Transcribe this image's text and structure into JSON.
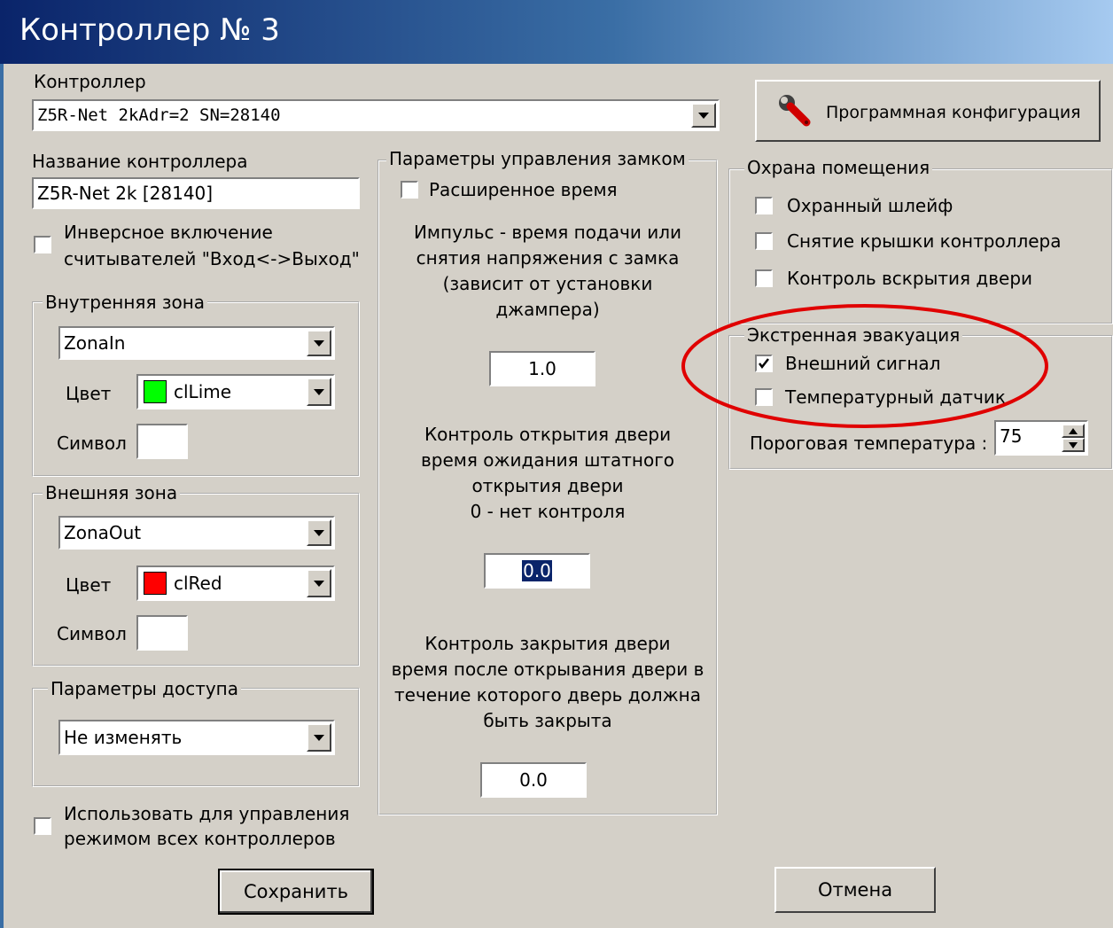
{
  "window": {
    "title": "Контроллер № 3"
  },
  "controller": {
    "label": "Контроллер",
    "value": "Z5R-Net 2kAdr=2 SN=28140"
  },
  "name": {
    "label": "Название контроллера",
    "value": "Z5R-Net 2k [28140]"
  },
  "inverse_readers": {
    "line1": "Инверсное включение",
    "line2": "считывателей \"Вход<->Выход\"",
    "checked": false
  },
  "inner_zone": {
    "title": "Внутренняя зона",
    "zone": "ZonaIn",
    "color_label": "Цвет",
    "color_value": "clLime",
    "color_hex": "#00ff00",
    "symbol_label": "Символ",
    "symbol_value": ""
  },
  "outer_zone": {
    "title": "Внешняя зона",
    "zone": "ZonaOut",
    "color_label": "Цвет",
    "color_value": "clRed",
    "color_hex": "#ff0000",
    "symbol_label": "Символ",
    "symbol_value": ""
  },
  "access": {
    "title": "Параметры доступа",
    "value": "Не изменять"
  },
  "use_for_all": {
    "line1": "Использовать для управления",
    "line2": "режимом всех контроллеров",
    "checked": false
  },
  "lock": {
    "title": "Параметры управления замком",
    "extended_time": {
      "label": "Расширенное время",
      "checked": false
    },
    "pulse": {
      "lines": [
        "Импульс - время подачи или",
        "снятия напряжения с замка",
        "(зависит от установки",
        "джампера)"
      ],
      "value": "1.0"
    },
    "open_control": {
      "lines": [
        "Контроль открытия двери",
        "время ожидания штатного",
        "открытия двери",
        "0 - нет контроля"
      ],
      "value": "0.0"
    },
    "close_control": {
      "lines": [
        "Контроль закрытия двери",
        "время после открывания двери в",
        "течение которого дверь должна",
        "быть закрыта"
      ],
      "value": "0.0"
    }
  },
  "prog_config": {
    "label": "Программная конфигурация",
    "icon": "wrench-icon"
  },
  "security": {
    "title": "Охрана помещения",
    "items": [
      {
        "label": "Охранный шлейф",
        "checked": false
      },
      {
        "label": "Снятие крышки контроллера",
        "checked": false
      },
      {
        "label": "Контроль вскрытия двери",
        "checked": false
      }
    ]
  },
  "evacuation": {
    "title": "Экстренная эвакуация",
    "items": [
      {
        "label": "Внешний сигнал",
        "checked": true
      },
      {
        "label": "Температурный датчик",
        "checked": false
      }
    ],
    "threshold_label": "Пороговая температура :",
    "threshold_value": "75"
  },
  "buttons": {
    "save": "Сохранить",
    "cancel": "Отмена"
  },
  "annotation_color": "#e00000"
}
